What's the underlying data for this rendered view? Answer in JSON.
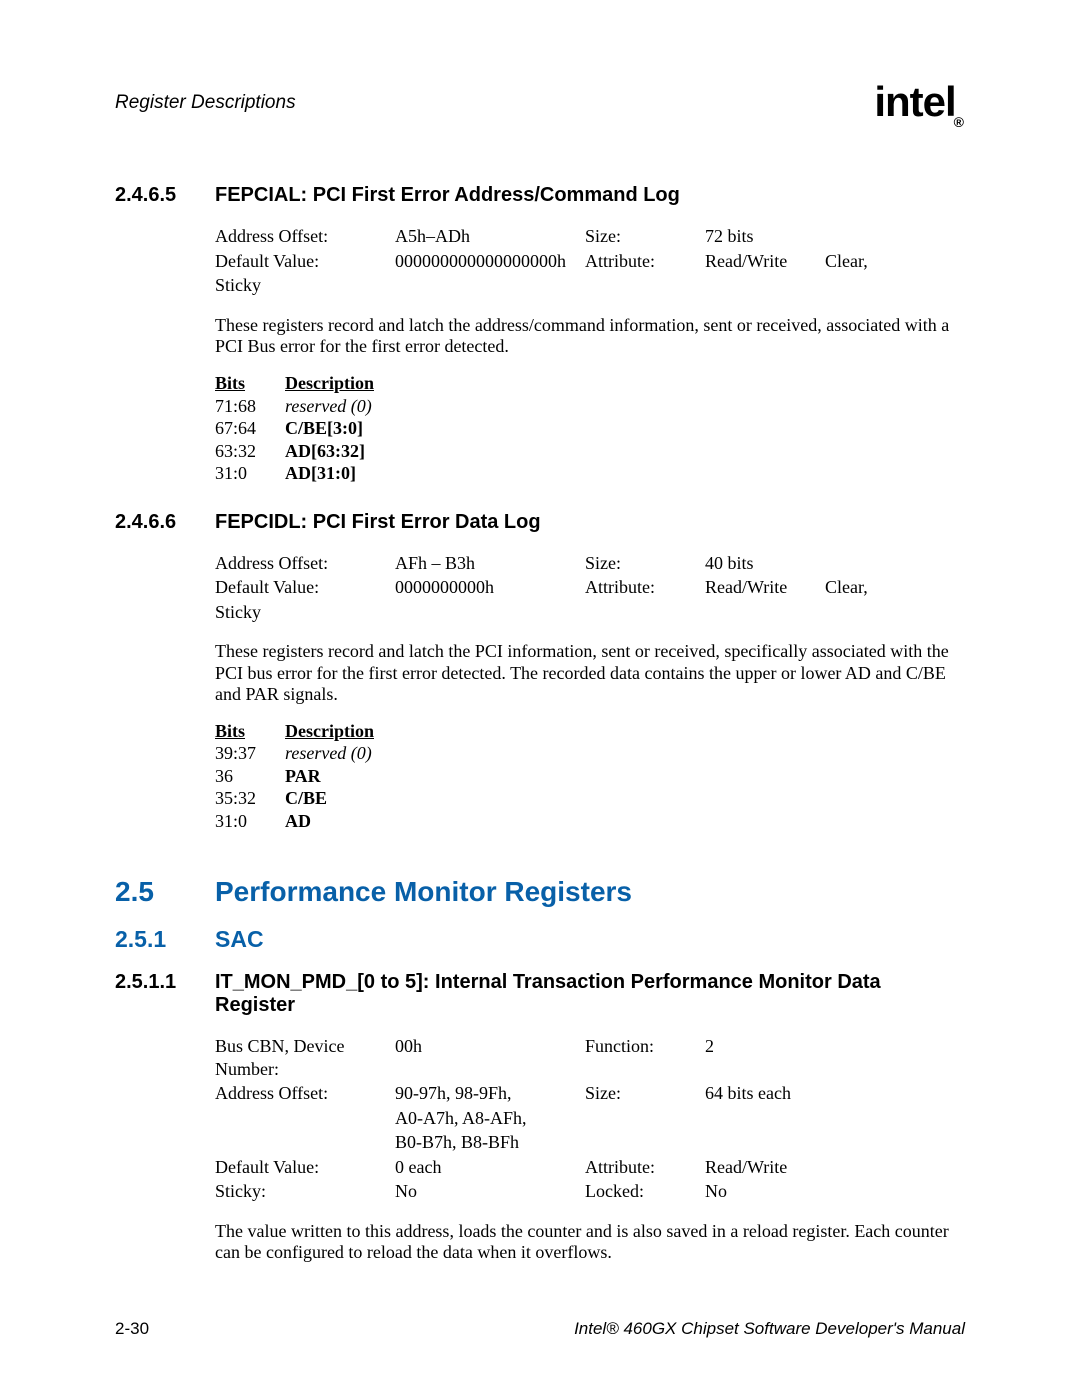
{
  "header": {
    "running_title": "Register Descriptions",
    "logo_text": "intel",
    "logo_reg": "®"
  },
  "sec_2465": {
    "num": "2.4.6.5",
    "title": "FEPCIAL: PCI First Error Address/Command Log",
    "kv": {
      "addr_offset_lbl": "Address Offset:",
      "addr_offset_val": "A5h–ADh",
      "size_lbl": "Size:",
      "size_val": "72 bits",
      "default_lbl": "Default Value:",
      "default_val": "000000000000000000h",
      "attr_lbl": "Attribute:",
      "attr_val": "Read/Write",
      "attr_extra": "Clear,",
      "sticky_lbl": "Sticky"
    },
    "para": "These registers record and latch the address/command information, sent or received, associated with a PCI Bus error for the first error detected.",
    "bits_header": {
      "c1": "Bits",
      "c2": "Description"
    },
    "bits": [
      {
        "c1": "71:68",
        "c2": "reserved (0)",
        "style": "ital"
      },
      {
        "c1": "67:64",
        "c2": "C/BE[3:0]",
        "style": "bold"
      },
      {
        "c1": "63:32",
        "c2": "AD[63:32]",
        "style": "bold"
      },
      {
        "c1": "31:0",
        "c2": "AD[31:0]",
        "style": "bold"
      }
    ]
  },
  "sec_2466": {
    "num": "2.4.6.6",
    "title": "FEPCIDL: PCI First Error Data Log",
    "kv": {
      "addr_offset_lbl": "Address Offset:",
      "addr_offset_val": "AFh – B3h",
      "size_lbl": "Size:",
      "size_val": "40 bits",
      "default_lbl": "Default Value:",
      "default_val": "0000000000h",
      "attr_lbl": "Attribute:",
      "attr_val": "Read/Write",
      "attr_extra": "Clear,",
      "sticky_lbl": "Sticky"
    },
    "para": "These registers record and latch the PCI information, sent or received, specifically associated with the PCI bus error for the first error detected. The recorded data contains the upper or lower AD and C/BE and PAR signals.",
    "bits_header": {
      "c1": "Bits",
      "c2": "Description"
    },
    "bits": [
      {
        "c1": "39:37",
        "c2": "reserved (0)",
        "style": "ital"
      },
      {
        "c1": "36",
        "c2": "PAR",
        "style": "bold"
      },
      {
        "c1": "35:32",
        "c2": "C/BE",
        "style": "bold"
      },
      {
        "c1": "31:0",
        "c2": "AD",
        "style": "bold"
      }
    ]
  },
  "sec_25": {
    "num": "2.5",
    "title": "Performance Monitor Registers"
  },
  "sec_251": {
    "num": "2.5.1",
    "title": "SAC"
  },
  "sec_2511": {
    "num": "2.5.1.1",
    "title": "IT_MON_PMD_[0 to 5]: Internal Transaction Performance Monitor Data Register",
    "kv": {
      "bus_lbl": "Bus CBN, Device Number:",
      "bus_val": "00h",
      "func_lbl": "Function:",
      "func_val": "2",
      "addr_lbl": "Address Offset:",
      "addr_val1": "90-97h, 98-9Fh,",
      "addr_val2": "A0-A7h, A8-AFh,",
      "addr_val3": "B0-B7h, B8-BFh",
      "size_lbl": "Size:",
      "size_val": "64 bits each",
      "default_lbl": "Default Value:",
      "default_val": "0 each",
      "attr_lbl": "Attribute:",
      "attr_val": "Read/Write",
      "sticky_lbl": "Sticky:",
      "sticky_val": "No",
      "locked_lbl": "Locked:",
      "locked_val": "No"
    },
    "para": "The value written to this address, loads the counter and is also saved in a reload register. Each counter can be configured to reload the data when it overflows."
  },
  "footer": {
    "left": "2-30",
    "right": "Intel® 460GX Chipset Software Developer's Manual"
  }
}
